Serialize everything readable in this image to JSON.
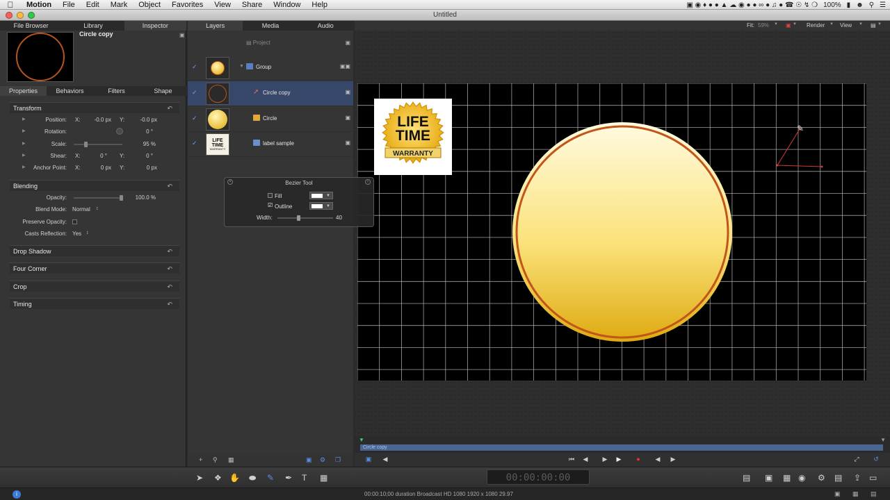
{
  "menubar": {
    "app": "Motion",
    "items": [
      "File",
      "Edit",
      "Mark",
      "Object",
      "Favorites",
      "View",
      "Share",
      "Window",
      "Help"
    ],
    "battery": "100%",
    "apple_icon": "apple-logo-icon",
    "search_icon": "spotlight-search-icon"
  },
  "window": {
    "title": "Untitled"
  },
  "inspector": {
    "tabs": [
      "File Browser",
      "Library",
      "Inspector"
    ],
    "object_name": "Circle copy",
    "subtabs": [
      "Properties",
      "Behaviors",
      "Filters",
      "Shape"
    ],
    "transform": {
      "header": "Transform",
      "position": {
        "label": "Position:",
        "x": "-0.0 px",
        "y": "-0.0 px"
      },
      "rotation": {
        "label": "Rotation:",
        "value": "0 °"
      },
      "scale": {
        "label": "Scale:",
        "value": "95 %"
      },
      "shear": {
        "label": "Shear:",
        "x": "0 °",
        "y": "0 °"
      },
      "anchor": {
        "label": "Anchor Point:",
        "x": "0 px",
        "y": "0 px"
      },
      "x_label": "X:",
      "y_label": "Y:"
    },
    "blending": {
      "header": "Blending",
      "opacity_label": "Opacity:",
      "opacity_value": "100.0 %",
      "blend_mode_label": "Blend Mode:",
      "blend_mode_value": "Normal",
      "preserve_label": "Preserve Opacity:",
      "casts_label": "Casts Reflection:",
      "casts_value": "Yes"
    },
    "collapsed_sections": [
      "Drop Shadow",
      "Four Corner",
      "Crop",
      "Timing"
    ]
  },
  "layers": {
    "tabs": [
      "Layers",
      "Media",
      "Audio"
    ],
    "project_label": "Project",
    "rows": [
      {
        "name": "Group"
      },
      {
        "name": "Circle copy"
      },
      {
        "name": "Circle"
      },
      {
        "name": "label sample"
      }
    ],
    "thumb_label": {
      "line1": "LIFE",
      "line2": "TIME",
      "line3": "WARRANTY"
    }
  },
  "bezier_hud": {
    "title": "Bezier Tool",
    "fill_label": "Fill",
    "outline_label": "Outline",
    "width_label": "Width:",
    "width_value": "40"
  },
  "canvas": {
    "fit_label": "Fit:",
    "fit_value": "59%",
    "render_label": "Render",
    "view_label": "View",
    "label_line1": "LIFE",
    "label_line2": "TIME",
    "label_line3": "WARRANTY",
    "colors": {
      "gold_top": "#fff6b8",
      "gold_bottom": "#e0a800",
      "ring": "#c2551a",
      "grid": "#bdbdbd"
    }
  },
  "timeline": {
    "bar_label": "Circle copy"
  },
  "timecode": "00:00:00:00",
  "statusbar": {
    "info": "00:00:10;00 duration Broadcast HD 1080 1920 x 1080 29.97"
  }
}
